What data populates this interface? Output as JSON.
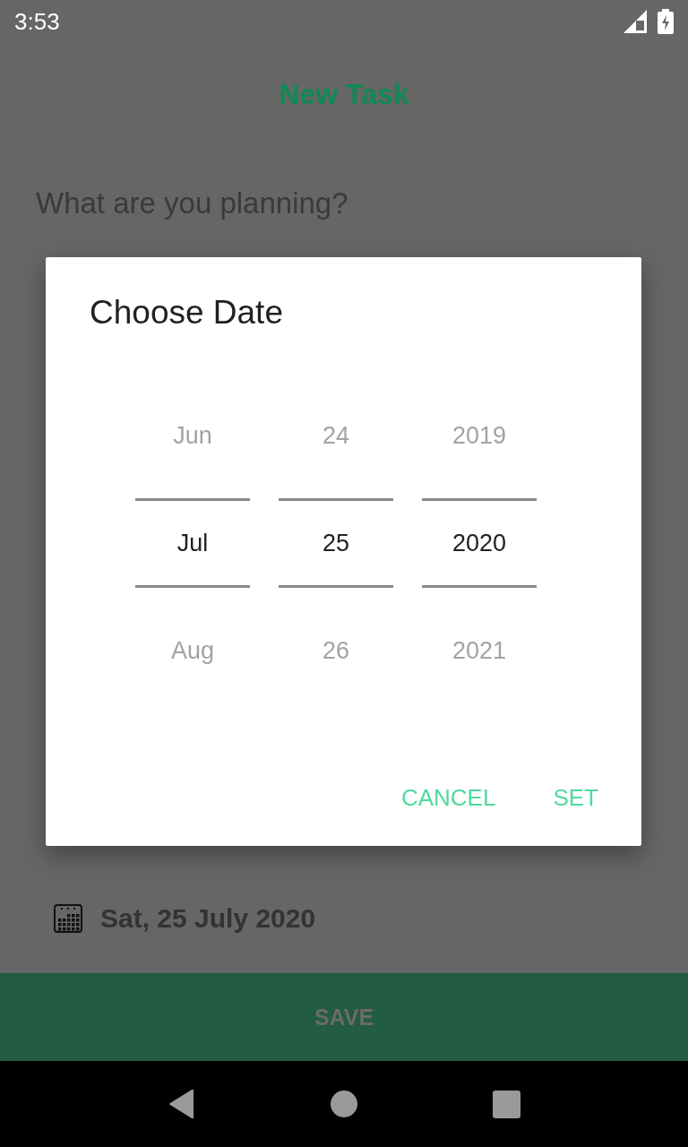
{
  "status_bar": {
    "time": "3:53"
  },
  "header": {
    "title": "New Task"
  },
  "task_input": {
    "placeholder": "What are you planning?"
  },
  "date_row": {
    "date": "Sat, 25 July 2020"
  },
  "save_button": {
    "label": "SAVE"
  },
  "dialog": {
    "title": "Choose Date",
    "pickers": [
      {
        "values": [
          {
            "text": "Jun",
            "selected": false
          },
          {
            "text": "Jul",
            "selected": true
          },
          {
            "text": "Aug",
            "selected": false
          }
        ]
      },
      {
        "values": [
          {
            "text": "24",
            "selected": false
          },
          {
            "text": "25",
            "selected": true
          },
          {
            "text": "26",
            "selected": false
          }
        ]
      },
      {
        "values": [
          {
            "text": "2019",
            "selected": false
          },
          {
            "text": "2020",
            "selected": true
          },
          {
            "text": "2021",
            "selected": false
          }
        ]
      }
    ],
    "buttons": [
      {
        "label": "CANCEL"
      },
      {
        "label": "SET"
      }
    ]
  }
}
